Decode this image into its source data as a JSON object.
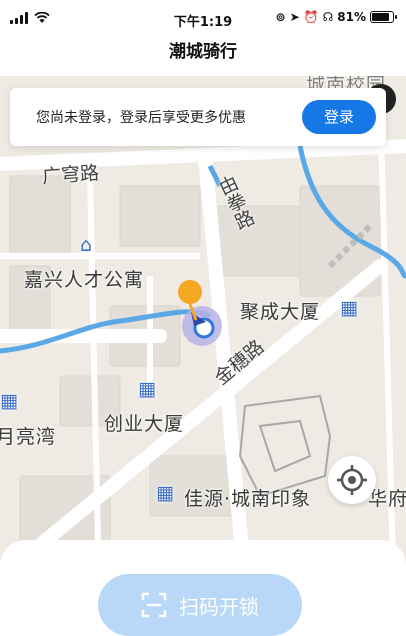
{
  "status_bar": {
    "time": "下午1:19",
    "battery": "81%",
    "battery_level": 0.81
  },
  "header": {
    "title": "潮城骑行"
  },
  "banner": {
    "message": "您尚未登录，登录后享受更多优惠",
    "login_label": "登录"
  },
  "map": {
    "pois": [
      {
        "name": "嘉兴人才公寓",
        "icon": "home-icon"
      },
      {
        "name": "聚成大厦",
        "icon": "building-icon"
      },
      {
        "name": "创业大厦",
        "icon": "building-icon"
      },
      {
        "name": "佳源·城南印象",
        "icon": "building-icon"
      },
      {
        "name": "月亮湾",
        "icon": "building-icon"
      }
    ],
    "roads": [
      "广穹路",
      "由拳路",
      "金穗路"
    ],
    "partial_labels": [
      "华府",
      "城南校园"
    ]
  },
  "bottom": {
    "scan_label": "扫码开锁"
  },
  "colors": {
    "accent": "#1677e6",
    "scan_button": "#b9d8f7",
    "water": "#5aa8e6",
    "map_bg": "#efebe4",
    "pin": "#f5a623"
  }
}
